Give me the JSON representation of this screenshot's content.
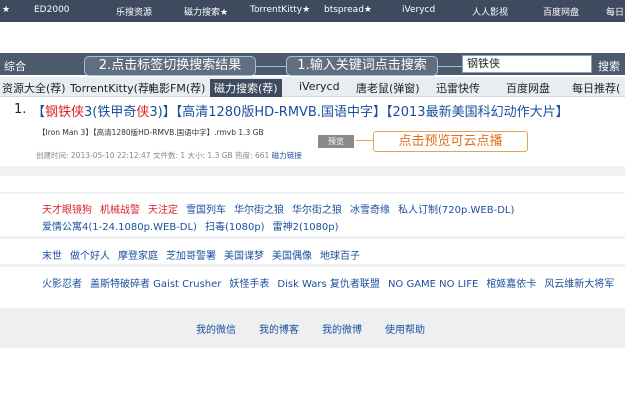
{
  "top_nav": [
    {
      "label": "★"
    },
    {
      "label": "ED2000"
    },
    {
      "label": "乐搜资源"
    },
    {
      "label": "磁力搜索★"
    },
    {
      "label": "TorrentKitty★"
    },
    {
      "label": "btspread★"
    },
    {
      "label": "iVerycd"
    },
    {
      "label": "人人影视"
    },
    {
      "label": "百度网盘"
    },
    {
      "label": "每日"
    }
  ],
  "search": {
    "site_label": "综合",
    "value": "钢铁侠",
    "button": "搜索"
  },
  "callouts": {
    "tab_tip": "2.点击标签切换搜索结果",
    "search_tip": "1.输入关键词点击搜索",
    "preview_tip": "点击预览可云点播"
  },
  "categories": [
    {
      "label": "资源大全(荐)"
    },
    {
      "label": "TorrentKitty(荐)"
    },
    {
      "label": "电影FM(荐)"
    },
    {
      "label": "磁力搜索(荐)",
      "active": true
    },
    {
      "label": "iVerycd"
    },
    {
      "label": "唐老鼠(弹窗)"
    },
    {
      "label": "迅雷快传"
    },
    {
      "label": "百度网盘"
    },
    {
      "label": "每日推荐("
    }
  ],
  "result": {
    "index": "1.",
    "title_parts": [
      {
        "text": "【",
        "hl": false
      },
      {
        "text": "钢铁侠",
        "hl": true
      },
      {
        "text": "3(铁甲奇",
        "hl": false
      },
      {
        "text": "侠",
        "hl": true
      },
      {
        "text": "3)】【高清1280版HD-RMVB.国语中字】【2013最新美国科幻动作大片】",
        "hl": false
      }
    ],
    "file": "【Iron Man 3】【高清1280版HD-RMVB.国语中字】.rmvb 1.3 GB",
    "meta": "创建时间: 2013-05-10 22:12:47   文件数: 1   大小: 1.3 GB   热度: 661",
    "magnet": "磁力链接",
    "preview": "预览"
  },
  "hot_rows": [
    [
      {
        "text": "天才眼镜狗",
        "red": true
      },
      {
        "text": "机械战警",
        "red": true
      },
      {
        "text": "天注定",
        "red": true
      },
      {
        "text": "雪国列车",
        "red": false
      },
      {
        "text": "华尔街之狼",
        "red": false
      },
      {
        "text": "华尔街之狼",
        "red": false
      },
      {
        "text": "冰雪奇缘",
        "red": false
      },
      {
        "text": "私人订制(720p.WEB-DL)",
        "red": false
      }
    ],
    [
      {
        "text": "爱情公寓4(1-24.1080p.WEB-DL)",
        "red": false
      },
      {
        "text": "扫毒(1080p)",
        "red": false
      },
      {
        "text": "雷神2(1080p)",
        "red": false
      }
    ],
    [
      {
        "text": "末世",
        "red": false
      },
      {
        "text": "做个好人",
        "red": false
      },
      {
        "text": "摩登家庭",
        "red": false
      },
      {
        "text": "芝加哥警署",
        "red": false
      },
      {
        "text": "美国谍梦",
        "red": false
      },
      {
        "text": "美国偶像",
        "red": false
      },
      {
        "text": "地球百子",
        "red": false
      }
    ],
    [
      {
        "text": "火影忍者",
        "red": false
      },
      {
        "text": "盖斯特破碎者 Gaist Crusher",
        "red": false
      },
      {
        "text": "妖怪手表",
        "red": false
      },
      {
        "text": "Disk Wars 复仇者联盟",
        "red": false
      },
      {
        "text": "NO GAME NO LIFE",
        "red": false
      },
      {
        "text": "棺姬嘉依卡",
        "red": false
      },
      {
        "text": "风云维新大将军",
        "red": false
      }
    ]
  ],
  "footer": [
    {
      "label": "我的微信"
    },
    {
      "label": "我的博客"
    },
    {
      "label": "我的微博"
    },
    {
      "label": "使用帮助"
    }
  ],
  "colors": {
    "nav_bg": "#3e4a5e",
    "link": "#1a4f9c",
    "highlight": "#e02020",
    "callout_orange": "#e46d1a"
  }
}
